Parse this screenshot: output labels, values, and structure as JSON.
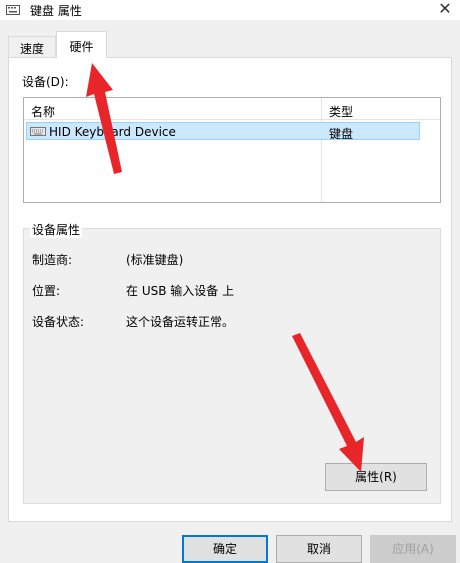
{
  "window": {
    "title": "键盘 属性",
    "close_glyph": "✕"
  },
  "tabs": [
    {
      "label": "速度",
      "selected": false
    },
    {
      "label": "硬件",
      "selected": true
    }
  ],
  "devices": {
    "label": "设备(D):",
    "columns": [
      "名称",
      "类型"
    ],
    "rows": [
      {
        "name": "HID Keyboard Device",
        "type": "键盘",
        "icon": "keyboard-icon",
        "selected": true
      }
    ]
  },
  "device_properties": {
    "group_label": "设备属性",
    "fields": [
      {
        "label": "制造商:",
        "value": "(标准键盘)"
      },
      {
        "label": "位置:",
        "value": "在 USB 输入设备 上"
      },
      {
        "label": "设备状态:",
        "value": "这个设备运转正常。"
      }
    ],
    "properties_button": "属性(R)"
  },
  "buttons": {
    "ok": "确定",
    "cancel": "取消",
    "apply": "应用(A)"
  },
  "colors": {
    "selection": "#cce8ff",
    "focus_border": "#0078d7",
    "annotation_arrow": "#e8262a"
  }
}
